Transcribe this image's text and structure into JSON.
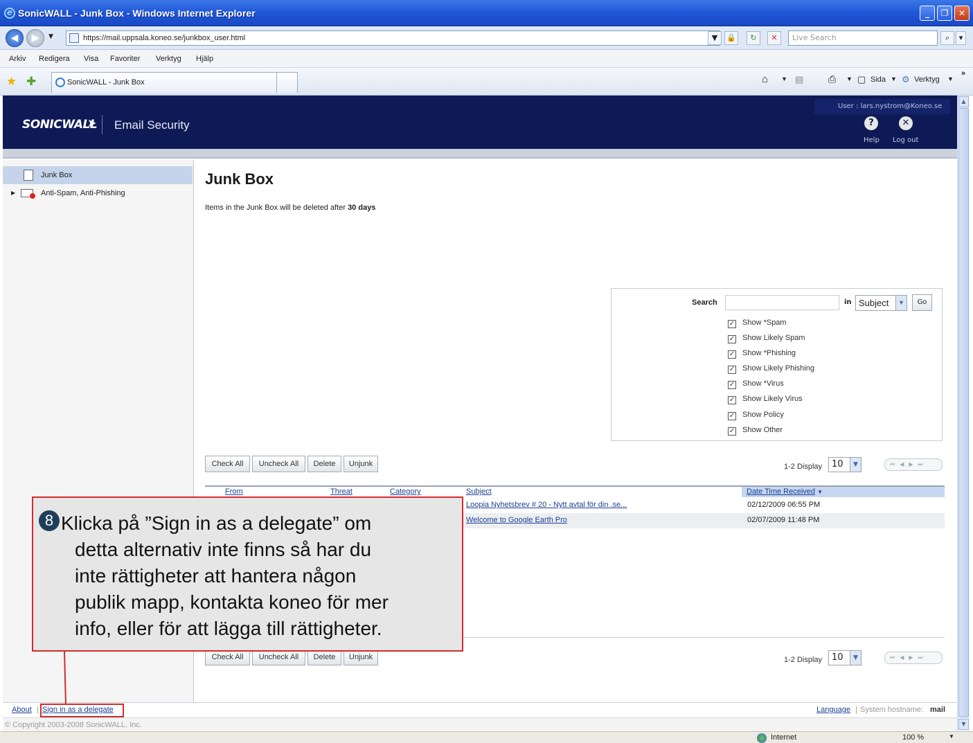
{
  "browser": {
    "window_title": "SonicWALL - Junk Box - Windows Internet Explorer",
    "url": "https://mail.uppsala.koneo.se/junkbox_user.html",
    "search_placeholder": "Live Search",
    "menu": [
      "Arkiv",
      "Redigera",
      "Visa",
      "Favoriter",
      "Verktyg",
      "Hjälp"
    ],
    "tab_title": "SonicWALL - Junk Box",
    "toolbar": {
      "page": "Sida",
      "tools": "Verktyg"
    },
    "status_zone": "Internet",
    "zoom": "100 %"
  },
  "header": {
    "logo": "SONICWALL",
    "product": "Email Security",
    "user": "User : lars.nystrom@Koneo.se",
    "help_label": "Help",
    "logout_label": "Log out"
  },
  "sidebar": {
    "items": [
      {
        "label": "Junk Box",
        "selected": true
      },
      {
        "label": "Anti-Spam, Anti-Phishing",
        "selected": false
      }
    ]
  },
  "main": {
    "title": "Junk Box",
    "notice_prefix": "Items in the Junk Box will be deleted after",
    "notice_days": "30 days"
  },
  "search": {
    "label": "Search",
    "in_label": "in",
    "field_value": "Subject",
    "go_label": "Go",
    "filters": [
      {
        "label": "Show *Spam",
        "checked": true
      },
      {
        "label": "Show Likely Spam",
        "checked": true
      },
      {
        "label": "Show *Phishing",
        "checked": true
      },
      {
        "label": "Show Likely Phishing",
        "checked": true
      },
      {
        "label": "Show *Virus",
        "checked": true
      },
      {
        "label": "Show Likely Virus",
        "checked": true
      },
      {
        "label": "Show Policy",
        "checked": true
      },
      {
        "label": "Show Other",
        "checked": true
      }
    ]
  },
  "actions": {
    "check_all": "Check All",
    "uncheck_all": "Uncheck All",
    "delete": "Delete",
    "unjunk": "Unjunk"
  },
  "pager": {
    "range_label": "1-2 Display",
    "display_value": "10"
  },
  "table": {
    "columns": {
      "from": "From",
      "threat": "Threat",
      "category": "Category",
      "subject": "Subject",
      "date": "Date Time Received"
    },
    "rows": [
      {
        "subject": "Loopia Nyhetsbrev # 20 - Nytt avtal för din .se...",
        "date": "02/12/2009 06:55 PM"
      },
      {
        "subject": "Welcome to Google Earth Pro",
        "date": "02/07/2009 11:48 PM"
      }
    ]
  },
  "footer": {
    "about": "About",
    "delegate": "Sign in as a delegate",
    "language": "Language",
    "hostname_label": "System hostname:",
    "hostname": "mail",
    "copyright": "© Copyright 2003-2008 SonicWALL, Inc."
  },
  "callout": {
    "number": "8",
    "lines": [
      "Klicka på ”Sign in as a delegate” om",
      "detta alternativ inte finns så har du",
      "inte rättigheter att hantera någon",
      "publik mapp, kontakta koneo för mer",
      "info, eller för att lägga till rättigheter."
    ],
    "accent": "#d42a2a"
  }
}
